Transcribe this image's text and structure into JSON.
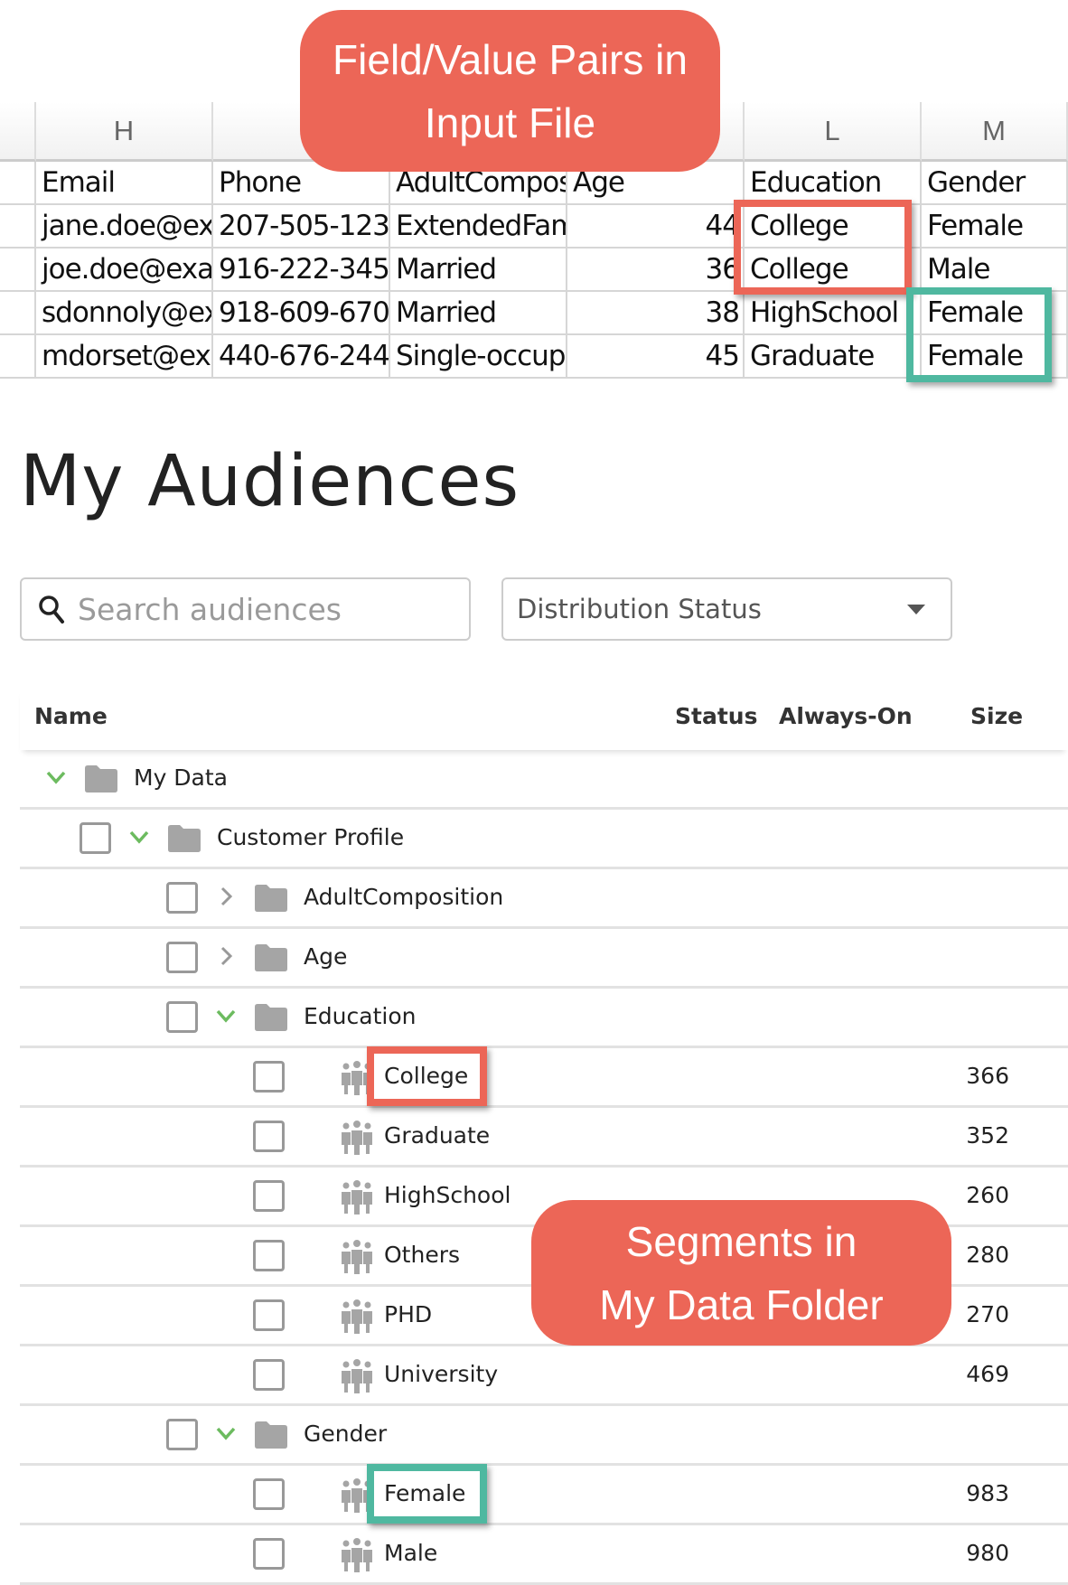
{
  "callouts": {
    "input_file": [
      "Field/Value Pairs in",
      "Input File"
    ],
    "segments": [
      "Segments in",
      "My Data Folder"
    ]
  },
  "spreadsheet": {
    "column_letters": [
      "H",
      "",
      "",
      "",
      "L",
      "M"
    ],
    "headers": [
      "Email",
      "Phone",
      "AdultCompos",
      "Age",
      "Education",
      "Gender"
    ],
    "rows": [
      [
        "jane.doe@ex",
        "207-505-123",
        "ExtendedFam",
        "44",
        "College",
        "Female"
      ],
      [
        "joe.doe@exa",
        "916-222-345",
        "Married",
        "36",
        "College",
        "Male"
      ],
      [
        "sdonnoly@ex",
        "918-609-670",
        "Married",
        "38",
        "HighSchool",
        "Female"
      ],
      [
        "mdorset@ex",
        "440-676-244",
        "Single-occupa",
        "45",
        "Graduate",
        "Female"
      ]
    ]
  },
  "highlight_colors": {
    "education": "#ec6657",
    "gender": "#4fb8a0"
  },
  "page": {
    "title": "My Audiences",
    "search_placeholder": "Search audiences",
    "distribution_status": "Distribution Status"
  },
  "table": {
    "columns": {
      "name": "Name",
      "status": "Status",
      "always_on": "Always-On",
      "size": "Size"
    },
    "rows": [
      {
        "level": 0,
        "type": "folder",
        "expanded": true,
        "checkbox": false,
        "label": "My Data",
        "size": ""
      },
      {
        "level": 1,
        "type": "folder",
        "expanded": true,
        "checkbox": true,
        "label": "Customer Profile",
        "size": ""
      },
      {
        "level": 2,
        "type": "folder",
        "expanded": false,
        "checkbox": true,
        "label": "AdultComposition",
        "size": ""
      },
      {
        "level": 2,
        "type": "folder",
        "expanded": false,
        "checkbox": true,
        "label": "Age",
        "size": ""
      },
      {
        "level": 2,
        "type": "folder",
        "expanded": true,
        "checkbox": true,
        "label": "Education",
        "size": ""
      },
      {
        "level": 3,
        "type": "segment",
        "checkbox": true,
        "label": "College",
        "size": "366",
        "highlight": "red"
      },
      {
        "level": 3,
        "type": "segment",
        "checkbox": true,
        "label": "Graduate",
        "size": "352"
      },
      {
        "level": 3,
        "type": "segment",
        "checkbox": true,
        "label": "HighSchool",
        "size": "260"
      },
      {
        "level": 3,
        "type": "segment",
        "checkbox": true,
        "label": "Others",
        "size": "280"
      },
      {
        "level": 3,
        "type": "segment",
        "checkbox": true,
        "label": "PHD",
        "size": "270"
      },
      {
        "level": 3,
        "type": "segment",
        "checkbox": true,
        "label": "University",
        "size": "469"
      },
      {
        "level": 2,
        "type": "folder",
        "expanded": true,
        "checkbox": true,
        "label": "Gender",
        "size": ""
      },
      {
        "level": 3,
        "type": "segment",
        "checkbox": true,
        "label": "Female",
        "size": "983",
        "highlight": "teal"
      },
      {
        "level": 3,
        "type": "segment",
        "checkbox": true,
        "label": "Male",
        "size": "980"
      }
    ]
  }
}
